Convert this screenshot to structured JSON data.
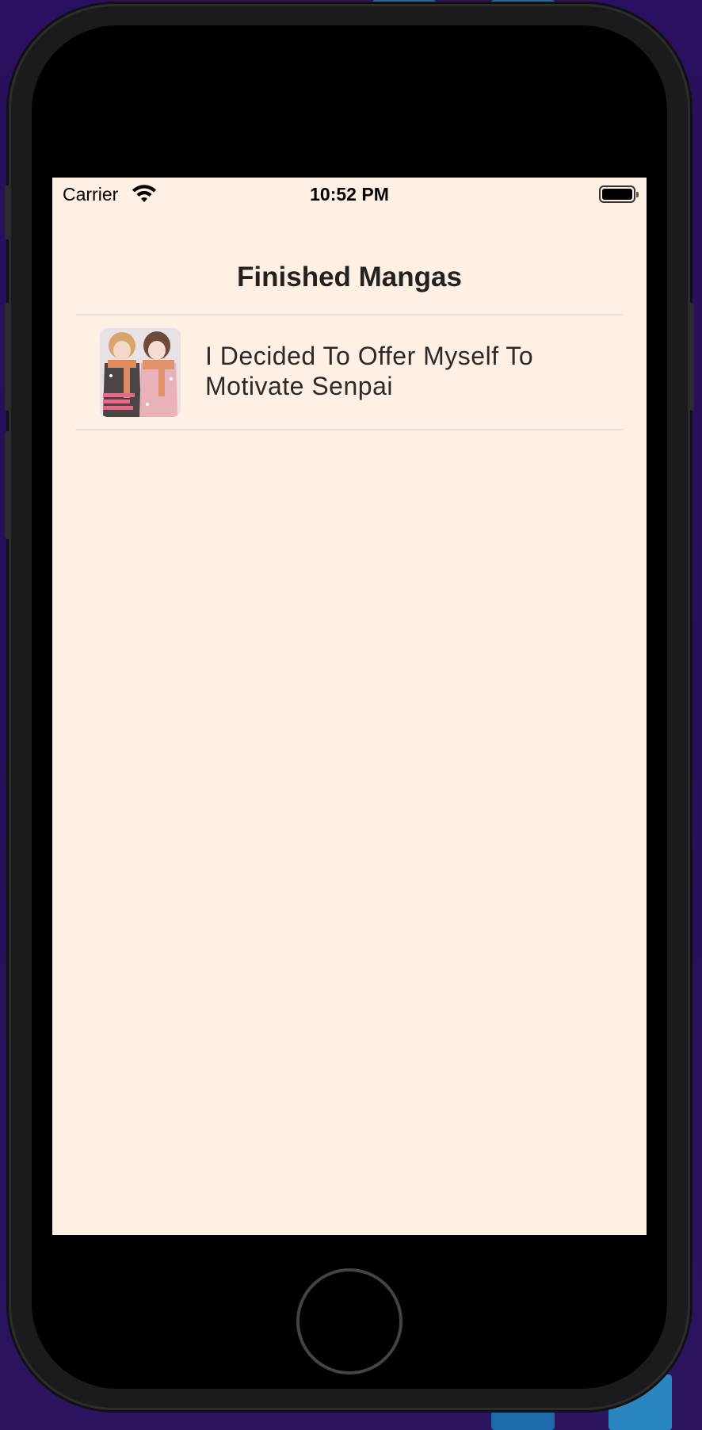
{
  "status_bar": {
    "carrier": "Carrier",
    "time": "10:52 PM"
  },
  "screen": {
    "title": "Finished Mangas",
    "background_color": "#fff0e3",
    "mangas": [
      {
        "title": "I Decided To Offer Myself To Motivate Senpai",
        "cover_icon": "manga-cover-image"
      }
    ]
  },
  "icons": {
    "wifi": "wifi-icon",
    "battery": "battery-icon",
    "home": "home-button"
  }
}
